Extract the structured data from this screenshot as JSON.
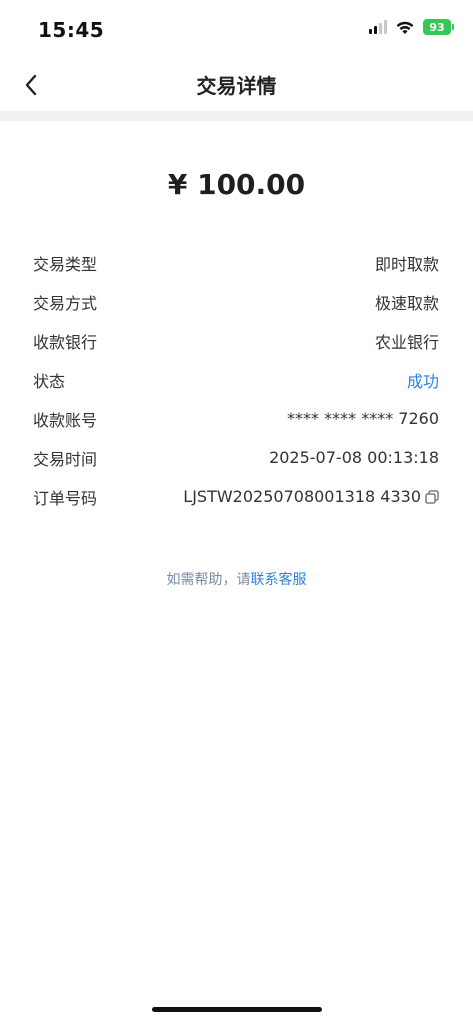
{
  "status_bar": {
    "time": "15:45",
    "battery": "93"
  },
  "nav": {
    "title": "交易详情"
  },
  "amount": "¥ 100.00",
  "details": [
    {
      "label": "交易类型",
      "value": "即时取款"
    },
    {
      "label": "交易方式",
      "value": "极速取款"
    },
    {
      "label": "收款银行",
      "value": "农业银行"
    },
    {
      "label": "状态",
      "value": "成功"
    },
    {
      "label": "收款账号",
      "value": "**** **** **** 7260"
    },
    {
      "label": "交易时间",
      "value": "2025-07-08 00:13:18"
    },
    {
      "label": "订单号码",
      "value": "LJSTW20250708001318 4330"
    }
  ],
  "help": {
    "prefix": "如需帮助，请",
    "link": "联系客服"
  },
  "colors": {
    "accent": "#2a82e4",
    "battery": "#34c759"
  }
}
